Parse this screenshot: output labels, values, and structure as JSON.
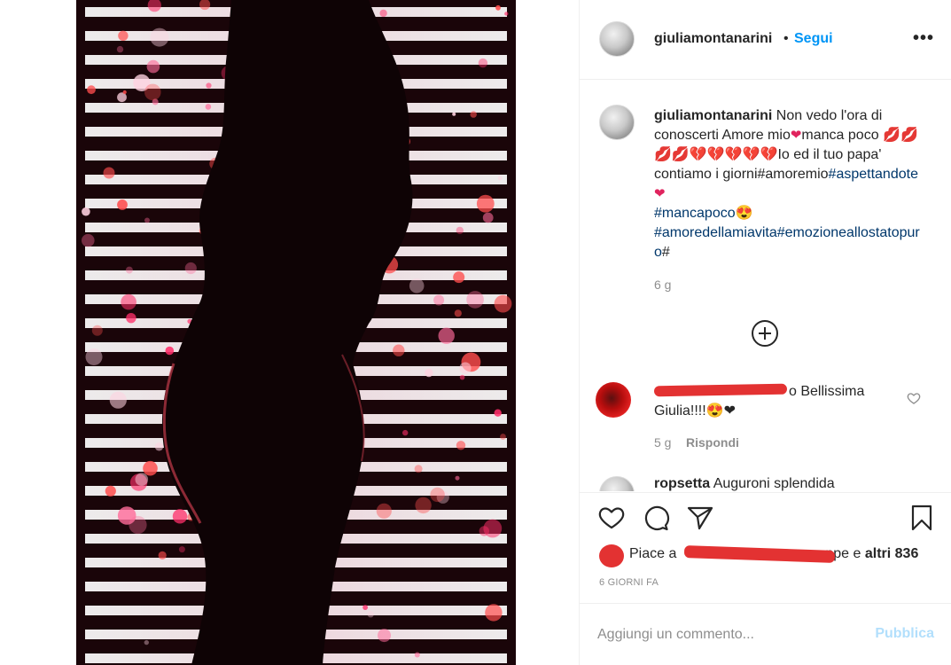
{
  "post": {
    "username": "giuliamontanarini",
    "separator": "•",
    "follow_label": "Segui",
    "more_icon": "more-horizontal-icon",
    "more_label": "•••"
  },
  "caption": {
    "username": "giuliamontanarini",
    "text_1": " Non vedo l'ora di conoscerti Amore mio",
    "text_2": "manca poco ",
    "kiss_emojis": "💋💋💋💋",
    "broken_hearts": "💔💔💔💔💔",
    "text_3": "Io ed il tuo papa' contiamo i giorni#",
    "text_4": "amoremio",
    "tag_1": "#aspettandote",
    "tag_2": "#mancapoco",
    "tag_3": "#amoredellamiavita",
    "tag_4": "#emozioneallostatopuro",
    "tail": "#",
    "heart": "❤",
    "star_eyes": "😍",
    "time": "6 g"
  },
  "comments": [
    {
      "username_redacted": true,
      "username_tail": "o",
      "text": " Bellissima Giulia!!!!",
      "emojis": "😍❤",
      "time": "5 g",
      "reply_label": "Rispondi"
    },
    {
      "username_partial": "ropsetta",
      "text": " Auguroni splendida"
    }
  ],
  "likes": {
    "prefix": "Piace a",
    "suffix_visible": "ppe e ",
    "others": "altri 836"
  },
  "date": "6 GIORNI FA",
  "add_comment": {
    "placeholder": "Aggiungi un commento...",
    "publish_label": "Pubblica"
  },
  "colors": {
    "link_blue": "#0095f6",
    "hashtag_blue": "#00376b",
    "publish_disabled": "#b2dffc",
    "redaction_red": "#e33232"
  }
}
